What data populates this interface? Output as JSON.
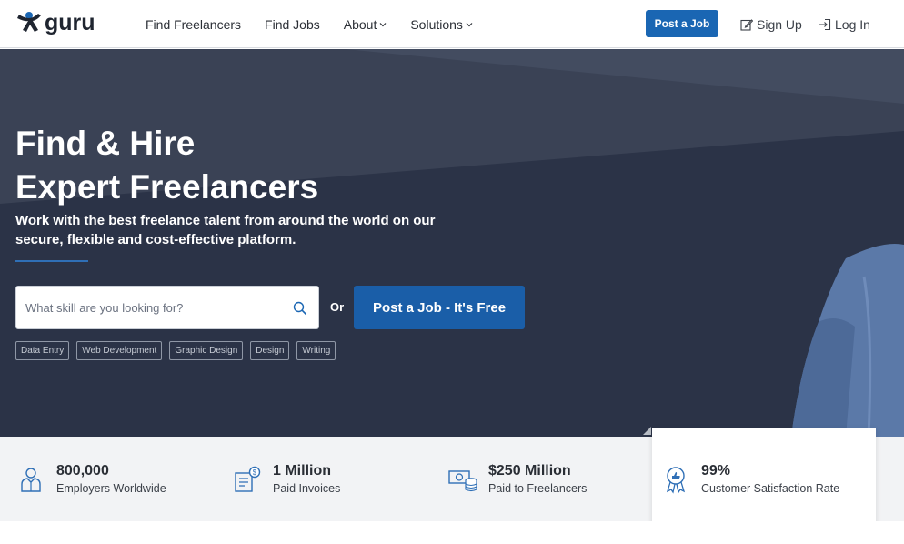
{
  "header": {
    "brand": "guru",
    "nav": [
      {
        "label": "Find Freelancers",
        "dropdown": false
      },
      {
        "label": "Find Jobs",
        "dropdown": false
      },
      {
        "label": "About",
        "dropdown": true
      },
      {
        "label": "Solutions",
        "dropdown": true
      }
    ],
    "post_job_label": "Post a Job",
    "sign_up_label": "Sign Up",
    "log_in_label": "Log In",
    "icons": {
      "sign_up": "edit-icon",
      "log_in": "login-icon",
      "dropdown": "chevron-down-icon"
    }
  },
  "hero": {
    "title_line1": "Find & Hire",
    "title_line2": "Expert Freelancers",
    "subtitle": "Work with the best freelance talent from around the world on our secure, flexible and cost-effective platform.",
    "search": {
      "placeholder": "What skill are you looking for?",
      "value": ""
    },
    "or_label": "Or",
    "cta_label": "Post a Job - It's Free",
    "tags": [
      "Data Entry",
      "Web Development",
      "Graphic Design",
      "Design",
      "Writing"
    ]
  },
  "stats": [
    {
      "value": "800,000",
      "label": "Employers Worldwide",
      "icon": "employer-icon"
    },
    {
      "value": "1 Million",
      "label": "Paid Invoices",
      "icon": "invoice-icon"
    },
    {
      "value": "$250 Million",
      "label": "Paid to Freelancers",
      "icon": "money-icon"
    },
    {
      "value": "99%",
      "label": "Customer Satisfaction Rate",
      "icon": "award-badge-icon"
    }
  ],
  "colors": {
    "brand_blue": "#1a66b3",
    "hero_bg": "#3a4255",
    "stats_bg": "#f2f3f5"
  }
}
